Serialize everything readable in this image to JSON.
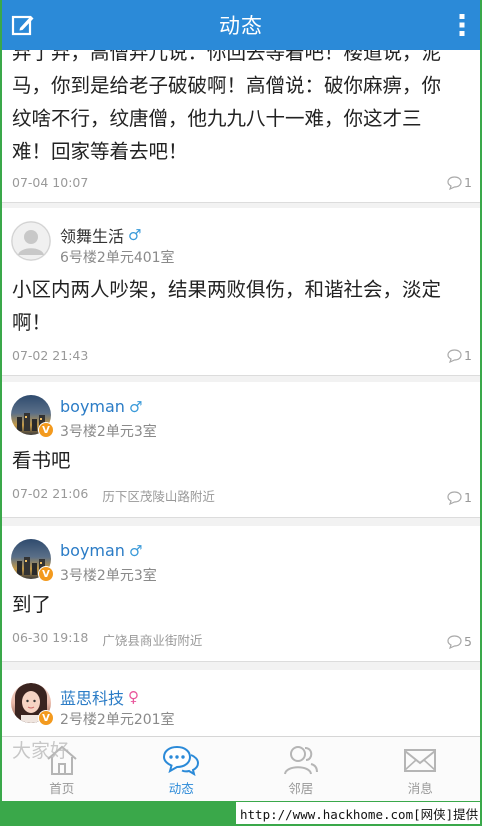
{
  "header": {
    "title": "动态",
    "left_icon": "compose-icon",
    "right_icon": "more-vertical-icon",
    "bar_color": "#2b8ad8"
  },
  "feed": {
    "posts": [
      {
        "text_lines": [
          "弃了弃，高僧弃儿说：你回去等着吧！楼道说，泥",
          "马，你到是给老子破破啊！高僧说：破你麻痹，你",
          "纹啥不行，纹唐僧，他九九八十一难，你这才三",
          "难！回家等着去吧！"
        ],
        "time": "07-04 10:07",
        "comments": "1"
      },
      {
        "name": "领舞生活",
        "gender": "♂",
        "address": "6号楼2单元401室",
        "text_lines": [
          "小区内两人吵架，结果两败俱伤，和谐社会，淡定",
          "啊！"
        ],
        "time": "07-02 21:43",
        "comments": "1"
      },
      {
        "name": "boyman",
        "gender": "♂",
        "verified": "V",
        "address": "3号楼2单元3室",
        "text_lines": [
          "看书吧"
        ],
        "time": "07-02 21:06",
        "location": "历下区茂陵山路附近",
        "comments": "1"
      },
      {
        "name": "boyman",
        "gender": "♂",
        "verified": "V",
        "address": "3号楼2单元3室",
        "text_lines": [
          "到了"
        ],
        "time": "06-30 19:18",
        "location": "广饶县商业街附近",
        "comments": "5"
      },
      {
        "name": "蓝思科技",
        "gender": "♀",
        "verified": "V",
        "address": "2号楼2单元201室",
        "text_lines": [
          "大家好"
        ]
      }
    ]
  },
  "tabbar": {
    "tabs": [
      {
        "label": "首页",
        "icon": "home-icon"
      },
      {
        "label": "动态",
        "icon": "chat-bubbles-icon",
        "active": true
      },
      {
        "label": "邻居",
        "icon": "neighbors-icon"
      },
      {
        "label": "消息",
        "icon": "mail-icon"
      }
    ],
    "active_color": "#2b8ad8"
  },
  "watermark": "http://www.hackhome.com[网侠]提供"
}
